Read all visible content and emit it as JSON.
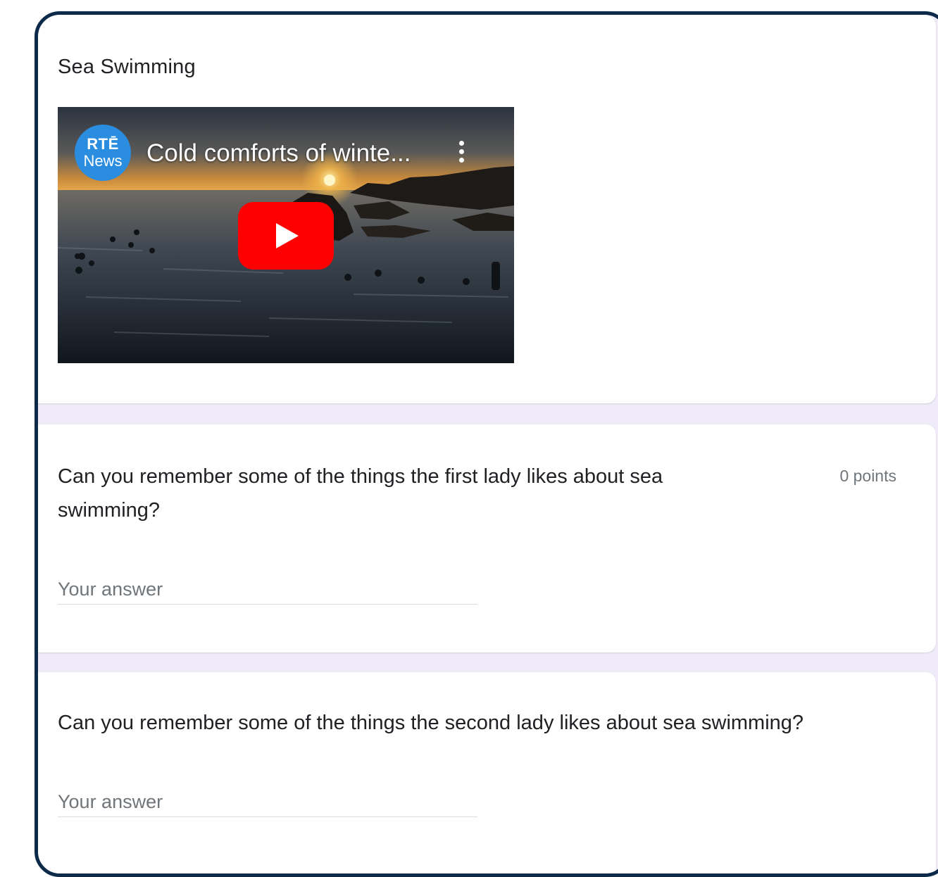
{
  "section": {
    "title": "Sea Swimming"
  },
  "video": {
    "channel_logo_line1": "RTĒ",
    "channel_logo_line2": "News",
    "title": "Cold comforts of winte...",
    "play_icon": "youtube-play-icon",
    "menu_icon": "kebab-menu-icon"
  },
  "questions": [
    {
      "text": "Can you remember some of the things the first lady likes about sea swimming?",
      "points": "0 points",
      "placeholder": "Your answer"
    },
    {
      "text": "Can you remember some of the things the second lady likes about sea swimming?",
      "placeholder": "Your answer"
    }
  ],
  "colors": {
    "frame_border": "#0d2a4a",
    "page_background": "#efebf8",
    "youtube_red": "#ff0000",
    "channel_blue": "#2a8de0"
  }
}
